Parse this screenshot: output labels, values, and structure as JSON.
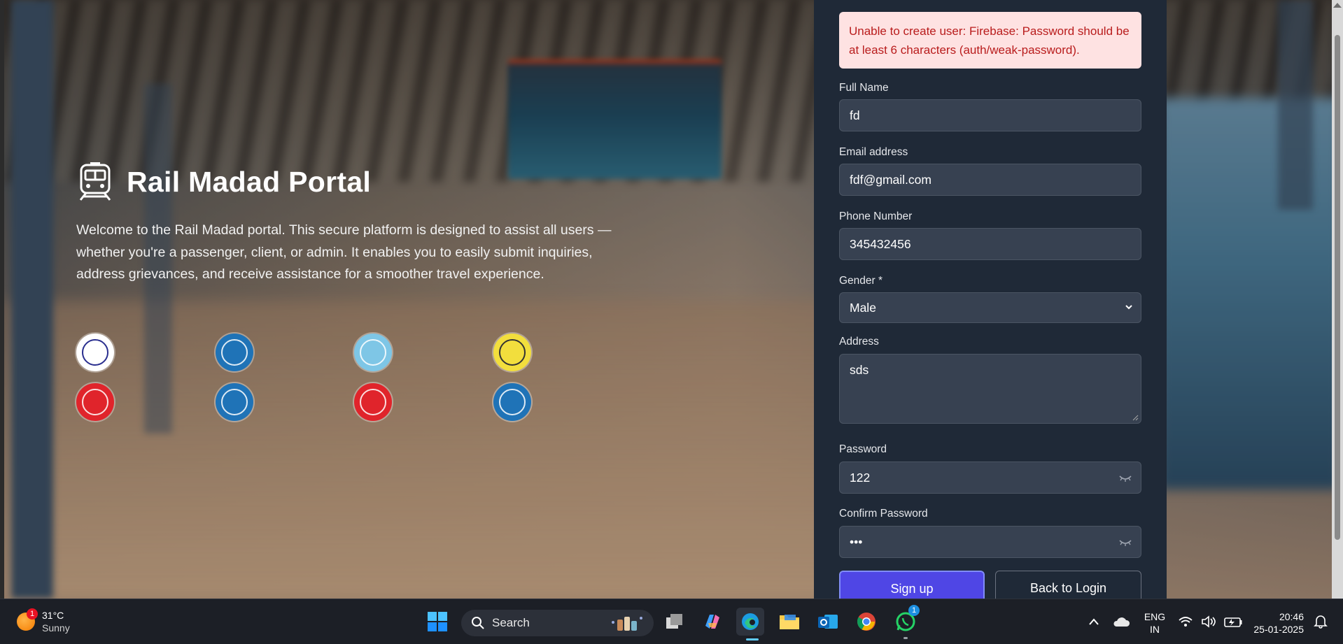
{
  "hero": {
    "title": "Rail Madad Portal",
    "description": "Welcome to the Rail Madad portal. This secure platform is designed to assist all users —whether you're a passenger, client, or admin. It enables you to easily submit inquiries, address grievances, and receive assistance for a smoother travel experience.",
    "logos": [
      {
        "name": "irctc-logo",
        "color": "#ffffff"
      },
      {
        "name": "indian-railways-logo",
        "color": "#1f73b7"
      },
      {
        "name": "indian-railways-light-logo",
        "color": "#7ec6e6"
      },
      {
        "name": "sleeper-berth-logo",
        "color": "#f2de3d"
      },
      {
        "name": "indian-railways-red-logo",
        "color": "#e0242b"
      },
      {
        "name": "indian-railways-logo",
        "color": "#1f73b7"
      },
      {
        "name": "indian-railways-red-logo",
        "color": "#e0242b"
      },
      {
        "name": "indian-railways-logo",
        "color": "#1f73b7"
      }
    ]
  },
  "form": {
    "error": "Unable to create user: Firebase: Password should be at least 6 characters (auth/weak-password).",
    "full_name_label": "Full Name",
    "full_name_value": "fd",
    "email_label": "Email address",
    "email_value": "fdf@gmail.com",
    "phone_label": "Phone Number",
    "phone_value": "345432456",
    "gender_label": "Gender *",
    "gender_value": "Male",
    "address_label": "Address",
    "address_value": "sds",
    "password_label": "Password",
    "password_value": "122",
    "confirm_password_label": "Confirm Password",
    "confirm_password_value": "•••",
    "signup_button": "Sign up",
    "back_button": "Back to Login"
  },
  "taskbar": {
    "weather_temp": "31°C",
    "weather_condition": "Sunny",
    "weather_badge": "1",
    "search_label": "Search",
    "whatsapp_badge": "1",
    "language": "ENG",
    "region": "IN",
    "time": "20:46",
    "date": "25-01-2025"
  },
  "colors": {
    "panel_bg": "#1f2937",
    "input_bg": "#374151",
    "error_bg": "#fee2e2",
    "error_text": "#b91c1c",
    "primary_button": "#4f46e5"
  }
}
